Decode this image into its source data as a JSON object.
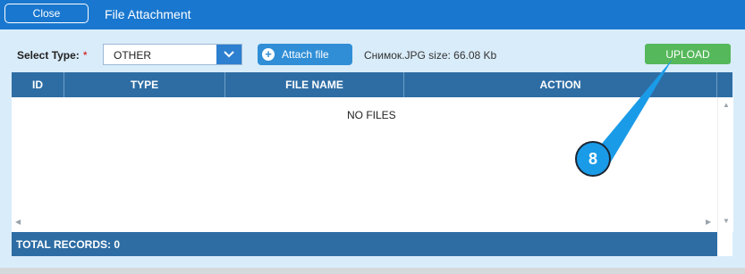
{
  "dialog": {
    "close_label": "Close",
    "title": "File Attachment"
  },
  "toolbar": {
    "select_type_label": "Select Type:",
    "required_marker": "*",
    "type_value": "OTHER",
    "attach_label": "Attach file",
    "file_info": "Снимок.JPG size: 66.08 Kb",
    "upload_label": "UPLOAD"
  },
  "grid": {
    "columns": [
      "ID",
      "TYPE",
      "FILE NAME",
      "ACTION"
    ],
    "empty_text": "NO FILES",
    "footer_text": "TOTAL RECORDS: 0"
  },
  "callout": {
    "number": "8",
    "color": "#1a9be8"
  },
  "colors": {
    "titlebar": "#1977cf",
    "upload": "#55b85a",
    "grid_header": "#2e6da4"
  },
  "icons": {
    "select_arrow": "chevron-down-icon",
    "attach": "plus-circle-icon",
    "scroll_up": "triangle-up-icon",
    "scroll_down": "triangle-down-icon",
    "scroll_left": "triangle-left-icon",
    "scroll_right": "triangle-right-icon"
  }
}
